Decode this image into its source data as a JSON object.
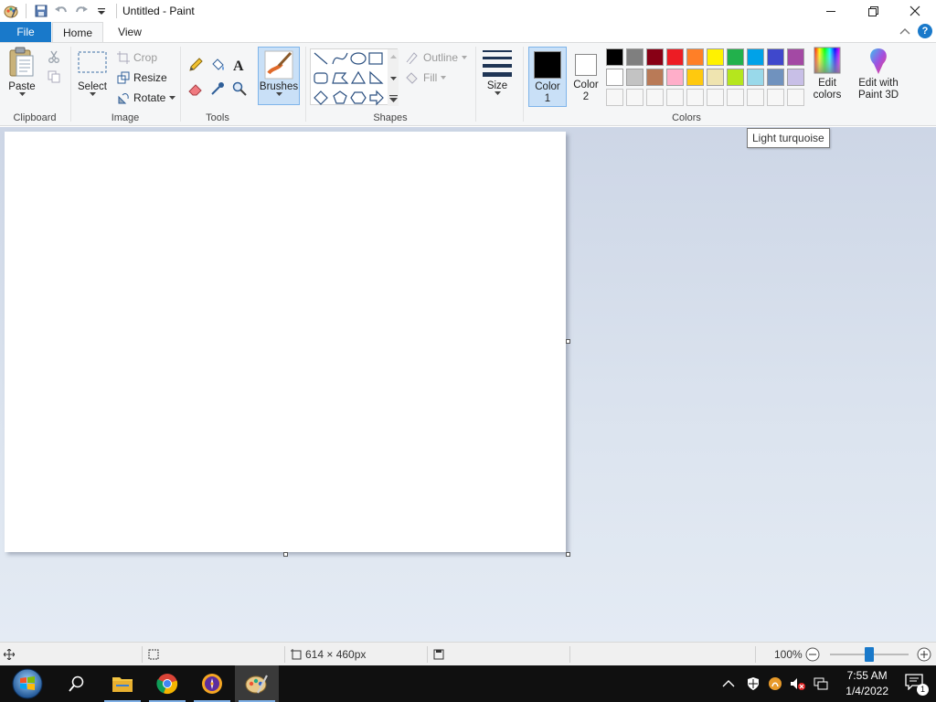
{
  "window": {
    "title": "Untitled - Paint",
    "quick_access": [
      "paint-app-icon",
      "save-icon",
      "undo-icon",
      "redo-icon",
      "customize-qat-icon"
    ]
  },
  "tabs": [
    {
      "label": "File"
    },
    {
      "label": "Home"
    },
    {
      "label": "View"
    }
  ],
  "ribbon": {
    "clipboard": {
      "group_label": "Clipboard",
      "paste_label": "Paste"
    },
    "image": {
      "group_label": "Image",
      "select_label": "Select",
      "crop_label": "Crop",
      "resize_label": "Resize",
      "rotate_label": "Rotate"
    },
    "tools": {
      "group_label": "Tools"
    },
    "brushes": {
      "label": "Brushes"
    },
    "shapes": {
      "group_label": "Shapes",
      "outline_label": "Outline",
      "fill_label": "Fill"
    },
    "size": {
      "label": "Size"
    },
    "colors": {
      "group_label": "Colors",
      "color1_label": "Color 1",
      "color1_value": "#000000",
      "color2_label": "Color 2",
      "color2_value": "#ffffff",
      "edit_colors_label": "Edit colors",
      "paint3d_label": "Edit with Paint 3D",
      "row1": [
        "#000000",
        "#7f7f7f",
        "#880015",
        "#ed1c24",
        "#ff7f27",
        "#fff200",
        "#22b14c",
        "#00a2e8",
        "#3f48cc",
        "#a349a4"
      ],
      "row2": [
        "#ffffff",
        "#c3c3c3",
        "#b97a57",
        "#ffaec9",
        "#ffc90e",
        "#efe4b0",
        "#b5e61d",
        "#99d9ea",
        "#7092be",
        "#c8bfe7"
      ],
      "row3_empty_count": 10
    }
  },
  "tooltip": {
    "text": "Light turquoise"
  },
  "statusbar": {
    "canvas_size": "614 × 460px",
    "zoom": "100%",
    "zoom_level_fraction": 0.5
  },
  "taskbar": {
    "apps": [
      "start-button",
      "search-icon",
      "file-explorer-icon",
      "chrome-icon",
      "browser-icon",
      "paint-icon"
    ],
    "time": "7:55 AM",
    "date": "1/4/2022",
    "notifications_count": "1"
  },
  "colors": {
    "accent": "#1979ca",
    "ribbon_bg": "#f5f6f7",
    "workspace_bg": "#cdd6e6",
    "taskbar_bg": "#101010"
  }
}
